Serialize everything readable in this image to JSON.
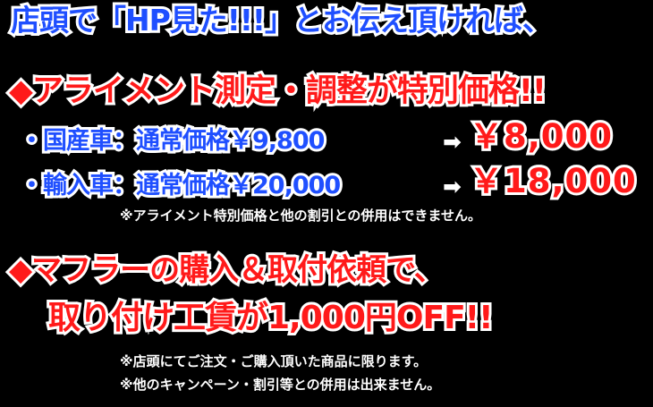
{
  "headline": "店頭で「HP見た!!!」とお伝え頂ければ、",
  "alignment": {
    "title": "◆アライメント測定・調整が特別価格!!",
    "rows": [
      {
        "label": "・国産車：通常価格￥9,800",
        "arrow": "➡",
        "new_price": "￥8,000"
      },
      {
        "label": "・輸入車：通常価格￥20,000",
        "arrow": "➡",
        "new_price": "￥18,000"
      }
    ],
    "note": "※アライメント特別価格と他の割引との併用はできません。"
  },
  "muffler": {
    "title": "◆マフラーの購入＆取付依頼で、",
    "subtitle": "取り付け工賃が1,000円OFF!!",
    "notes": [
      "※店頭にてご注文・ご購入頂いた商品に限ります。",
      "※他のキャンペーン・割引等との併用は出来ません。"
    ]
  },
  "colors": {
    "background": "#000000",
    "blue_text": "#1f4fff",
    "red_text": "#ff1a1a",
    "outline": "#ffffff"
  }
}
